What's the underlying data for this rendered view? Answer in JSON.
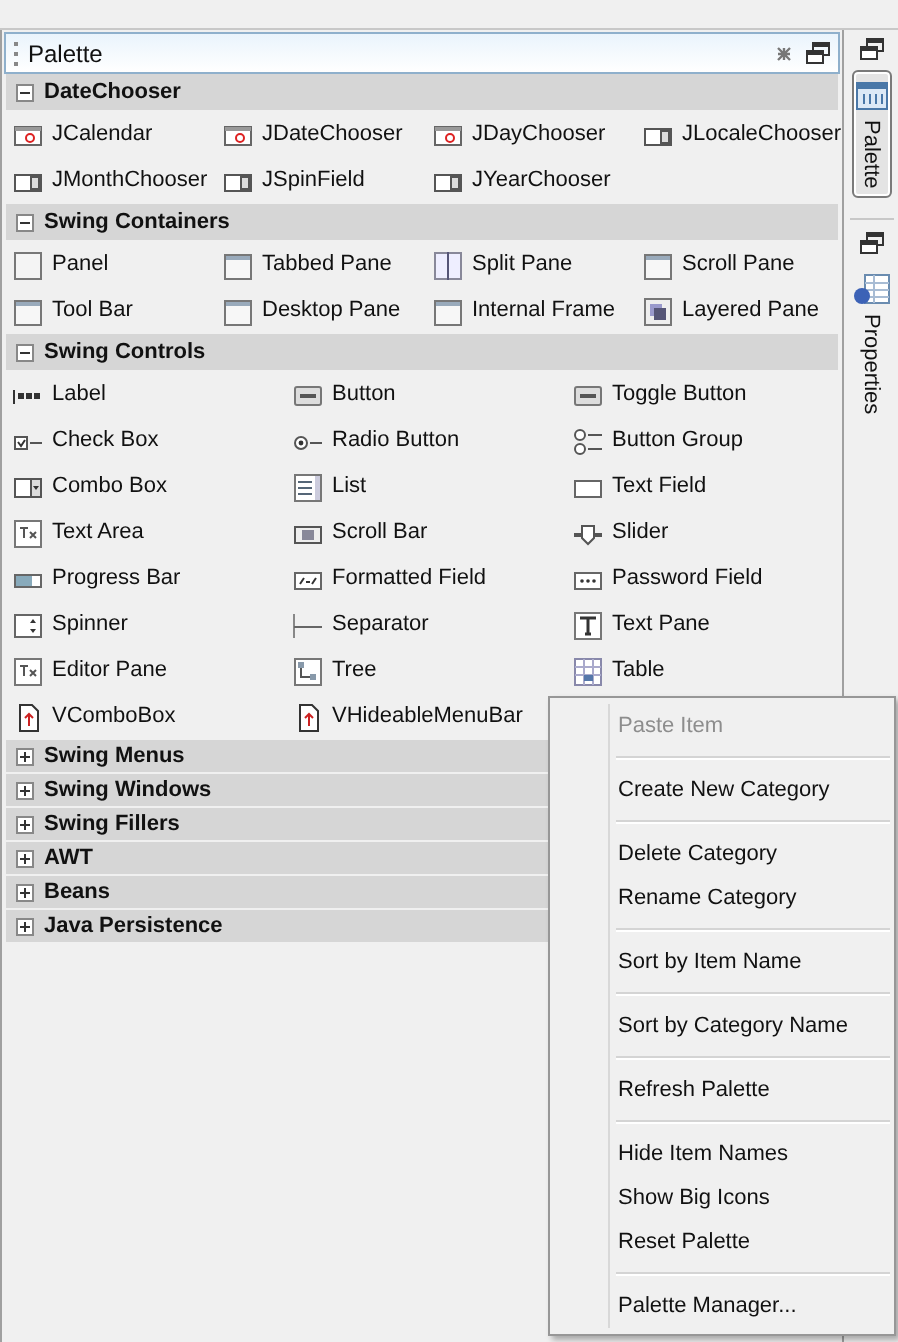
{
  "panel": {
    "title": "Palette"
  },
  "categories": [
    {
      "name": "DateChooser",
      "expanded": true,
      "items": [
        "JCalendar",
        "JDateChooser",
        "JDayChooser",
        "JLocaleChooser",
        "JMonthChooser",
        "JSpinField",
        "JYearChooser"
      ]
    },
    {
      "name": "Swing Containers",
      "expanded": true,
      "items": [
        "Panel",
        "Tabbed Pane",
        "Split Pane",
        "Scroll Pane",
        "Tool Bar",
        "Desktop Pane",
        "Internal Frame",
        "Layered Pane"
      ]
    },
    {
      "name": "Swing Controls",
      "expanded": true,
      "items": [
        "Label",
        "Button",
        "Toggle Button",
        "Check Box",
        "Radio Button",
        "Button Group",
        "Combo Box",
        "List",
        "Text Field",
        "Text Area",
        "Scroll Bar",
        "Slider",
        "Progress Bar",
        "Formatted Field",
        "Password Field",
        "Spinner",
        "Separator",
        "Text Pane",
        "Editor Pane",
        "Tree",
        "Table",
        "VComboBox",
        "VHideableMenuBar"
      ]
    },
    {
      "name": "Swing Menus",
      "expanded": false
    },
    {
      "name": "Swing Windows",
      "expanded": false
    },
    {
      "name": "Swing Fillers",
      "expanded": false
    },
    {
      "name": "AWT",
      "expanded": false
    },
    {
      "name": "Beans",
      "expanded": false
    },
    {
      "name": "Java Persistence",
      "expanded": false
    }
  ],
  "side_tabs": [
    {
      "label": "Palette",
      "selected": true
    },
    {
      "label": "Properties",
      "selected": false
    }
  ],
  "context_menu": {
    "groups": [
      [
        {
          "label": "Paste Item",
          "disabled": true
        }
      ],
      [
        {
          "label": "Create New Category",
          "disabled": false
        }
      ],
      [
        {
          "label": "Delete Category",
          "disabled": false
        },
        {
          "label": "Rename Category",
          "disabled": false
        }
      ],
      [
        {
          "label": "Sort by Item Name",
          "disabled": false
        }
      ],
      [
        {
          "label": "Sort by Category Name",
          "disabled": false
        }
      ],
      [
        {
          "label": "Refresh Palette",
          "disabled": false
        }
      ],
      [
        {
          "label": "Hide Item Names",
          "disabled": false
        },
        {
          "label": "Show Big Icons",
          "disabled": false
        },
        {
          "label": "Reset Palette",
          "disabled": false
        }
      ],
      [
        {
          "label": "Palette Manager...",
          "disabled": false
        }
      ]
    ]
  }
}
